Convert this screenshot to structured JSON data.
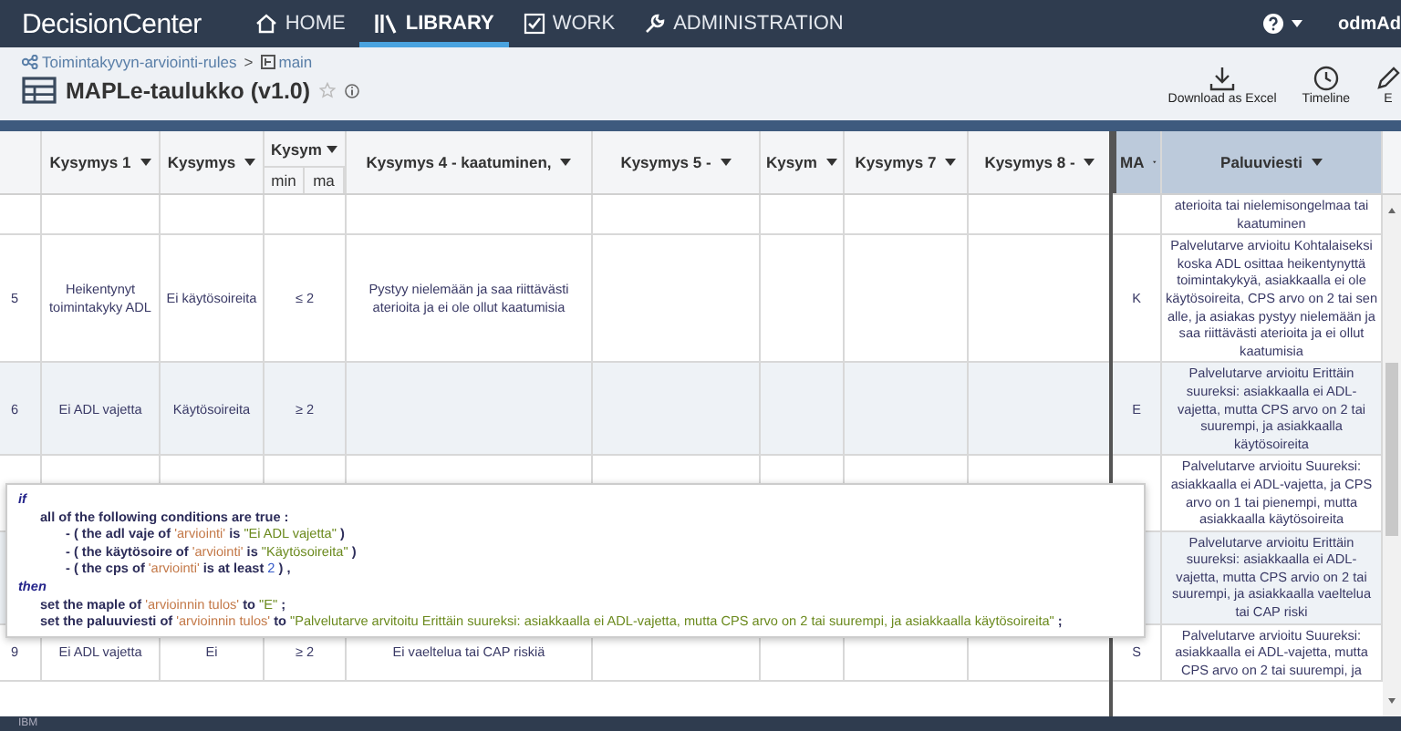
{
  "app": {
    "logo": "DecisionCenter",
    "user": "odmAd"
  },
  "nav": [
    {
      "label": "HOME",
      "selected": false
    },
    {
      "label": "LIBRARY",
      "selected": true
    },
    {
      "label": "WORK",
      "selected": false
    },
    {
      "label": "ADMINISTRATION",
      "selected": false
    }
  ],
  "breadcrumb": {
    "project": "Toimintakyvyn-arviointi-rules",
    "separator": ">",
    "branch": "main"
  },
  "title": "MAPLe-taulukko (v1.0)",
  "toolbar": [
    {
      "label": "Download as Excel"
    },
    {
      "label": "Timeline"
    },
    {
      "label": "E"
    }
  ],
  "table": {
    "columns": [
      {
        "label": "Kysymys 1",
        "kind": "condition"
      },
      {
        "label": "Kysymys",
        "kind": "condition"
      },
      {
        "label": "Kysym",
        "kind": "condition",
        "subcolumns": [
          "min",
          "ma"
        ]
      },
      {
        "label": "Kysymys 4 - kaatuminen,",
        "kind": "condition"
      },
      {
        "label": "Kysymys 5 -",
        "kind": "condition"
      },
      {
        "label": "Kysym",
        "kind": "condition"
      },
      {
        "label": "Kysymys 7",
        "kind": "condition"
      },
      {
        "label": "Kysymys 8 -",
        "kind": "condition"
      },
      {
        "label": "MA",
        "kind": "action"
      },
      {
        "label": "Paluuviesti",
        "kind": "action"
      }
    ],
    "rows": [
      {
        "cells": [
          null,
          null,
          null,
          null,
          null,
          null,
          null,
          null,
          null,
          "aterioita tai nielemisongelmaa tai kaatuminen"
        ]
      },
      {
        "number": "5",
        "cells": [
          "Heikentynyt toimintakyky ADL",
          "Ei käytösoireita",
          "≤ 2",
          "Pystyy nielemään ja saa riittävästi aterioita ja ei ole ollut kaatumisia",
          null,
          null,
          null,
          null,
          "K",
          "Palvelutarve arvioitu Kohtalaiseksi koska ADL osittaa heikentynyttä toimintakykyä, asiakkaalla ei ole käytösoireita, CPS arvo on 2 tai sen alle, ja asiakas pystyy nielemään ja saa riittävästi aterioita ja ei ollut kaatumisia"
        ]
      },
      {
        "number": "6",
        "cells": [
          "Ei ADL vajetta",
          "Käytösoireita",
          "≥ 2",
          null,
          null,
          null,
          null,
          null,
          "E",
          "Palvelutarve arvioitu Erittäin suureksi: asiakkaalla ei ADL-vajetta, mutta CPS arvo on 2 tai suurempi, ja asiakkaalla käytösoireita"
        ]
      },
      {
        "cells": [
          null,
          null,
          null,
          null,
          null,
          null,
          null,
          null,
          null,
          "Palvelutarve arvioitu Suureksi: asiakkaalla ei ADL-vajetta, ja CPS arvo on 1 tai pienempi, mutta asiakkaalla käytösoireita"
        ]
      },
      {
        "cells": [
          null,
          null,
          null,
          null,
          null,
          null,
          null,
          null,
          null,
          "Palvelutarve arvioitu Erittäin suureksi: asiakkaalla ei ADL-vajetta, mutta CPS arvio on 2 tai suurempi, ja asiakkaalla vaeltelua tai CAP riski"
        ]
      },
      {
        "number": "9",
        "cells": [
          "Ei ADL vajetta",
          "Ei",
          "≥ 2",
          "Ei vaeltelua tai CAP riskiä",
          null,
          null,
          null,
          null,
          "S",
          "Palvelutarve arvioitu Suureksi: asiakkaalla ei ADL-vajetta, mutta CPS arvo on 2 tai suurempi, ja"
        ]
      }
    ]
  },
  "rule_tooltip": {
    "lines": [
      {
        "segments": [
          {
            "kind": "keyword",
            "text": "if"
          }
        ],
        "children": [
          {
            "segments": [
              {
                "kind": "text",
                "text": "all of the following conditions are true :"
              }
            ],
            "children": [
              {
                "segments": [
                  {
                    "kind": "text",
                    "text": "- ( the adl vaje of "
                  },
                  {
                    "kind": "variable",
                    "text": "'arviointi'"
                  },
                  {
                    "kind": "text",
                    "text": " is "
                  },
                  {
                    "kind": "value",
                    "text": "\"Ei ADL vajetta\""
                  },
                  {
                    "kind": "text",
                    "text": " )"
                  }
                ]
              },
              {
                "segments": [
                  {
                    "kind": "text",
                    "text": "- ( the käytösoire of "
                  },
                  {
                    "kind": "variable",
                    "text": "'arviointi'"
                  },
                  {
                    "kind": "text",
                    "text": " is "
                  },
                  {
                    "kind": "value",
                    "text": "\"Käytösoireita\""
                  },
                  {
                    "kind": "text",
                    "text": " )"
                  }
                ]
              },
              {
                "segments": [
                  {
                    "kind": "text",
                    "text": "- ( the cps of "
                  },
                  {
                    "kind": "variable",
                    "text": "'arviointi'"
                  },
                  {
                    "kind": "text",
                    "text": " is at least "
                  },
                  {
                    "kind": "number",
                    "text": "2"
                  },
                  {
                    "kind": "text",
                    "text": " ) ,"
                  }
                ]
              }
            ]
          }
        ]
      },
      {
        "segments": [
          {
            "kind": "keyword",
            "text": "then"
          }
        ],
        "children": [
          {
            "segments": [
              {
                "kind": "text",
                "text": "set the maple of "
              },
              {
                "kind": "variable",
                "text": "'arvioinnin tulos'"
              },
              {
                "kind": "text",
                "text": " to "
              },
              {
                "kind": "value",
                "text": "\"E\""
              },
              {
                "kind": "text",
                "text": " ;"
              }
            ]
          },
          {
            "segments": [
              {
                "kind": "text",
                "text": "set the paluuviesti of "
              },
              {
                "kind": "variable",
                "text": "'arvioinnin tulos'"
              },
              {
                "kind": "text",
                "text": " to "
              },
              {
                "kind": "value",
                "text": "\"Palvelutarve arvitoitu Erittäin suureksi: asiakkaalla ei ADL-vajetta, mutta CPS arvo on 2 tai suurempi, ja asiakkaalla käytösoireita\""
              },
              {
                "kind": "text",
                "text": " ;"
              }
            ]
          }
        ]
      }
    ]
  },
  "footer": "IBM"
}
